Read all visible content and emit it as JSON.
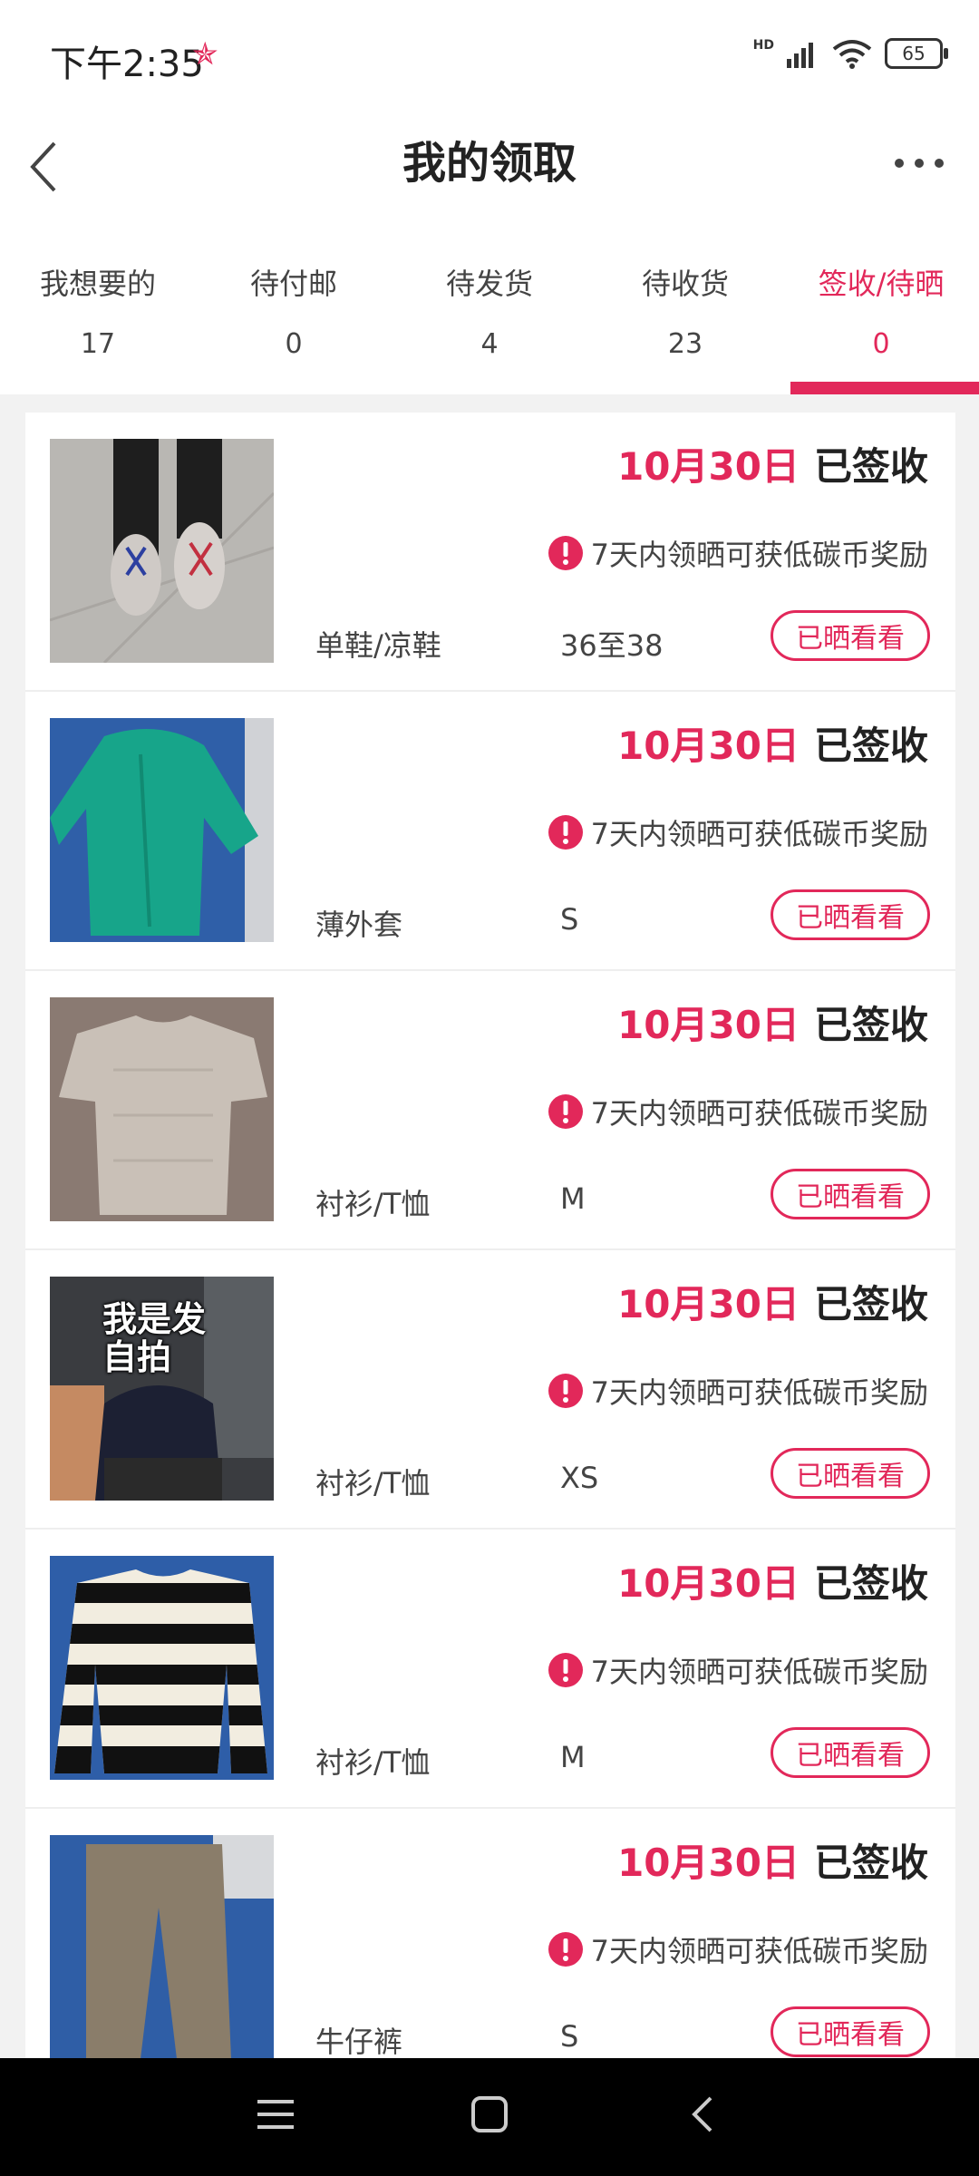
{
  "status_bar": {
    "time": "下午2:35",
    "battery": "65",
    "network": "HD"
  },
  "header": {
    "title": "我的领取"
  },
  "tabs": [
    {
      "label": "我想要的",
      "count": "17"
    },
    {
      "label": "待付邮",
      "count": "0"
    },
    {
      "label": "待发货",
      "count": "4"
    },
    {
      "label": "待收货",
      "count": "23"
    },
    {
      "label": "签收/待晒",
      "count": "0"
    }
  ],
  "active_tab": "签收/待晒",
  "colors": {
    "accent": "#e2285a",
    "text": "#333333",
    "background": "#f2f2f2"
  },
  "items": [
    {
      "date": "10月30日",
      "status": "已签收",
      "reward_text": "7天内领晒可获低碳币奖励",
      "category": "单鞋/凉鞋",
      "size": "36至38",
      "button": "已晒看看"
    },
    {
      "date": "10月30日",
      "status": "已签收",
      "reward_text": "7天内领晒可获低碳币奖励",
      "category": "薄外套",
      "size": "S",
      "button": "已晒看看"
    },
    {
      "date": "10月30日",
      "status": "已签收",
      "reward_text": "7天内领晒可获低碳币奖励",
      "category": "衬衫/T恤",
      "size": "M",
      "button": "已晒看看"
    },
    {
      "date": "10月30日",
      "status": "已签收",
      "reward_text": "7天内领晒可获低碳币奖励",
      "category": "衬衫/T恤",
      "size": "XS",
      "button": "已晒看看",
      "photo_overlay": "我是发自拍"
    },
    {
      "date": "10月30日",
      "status": "已签收",
      "reward_text": "7天内领晒可获低碳币奖励",
      "category": "衬衫/T恤",
      "size": "M",
      "button": "已晒看看"
    },
    {
      "date": "10月30日",
      "status": "已签收",
      "reward_text": "7天内领晒可获低碳币奖励",
      "category": "牛仔裤",
      "size": "S",
      "button": "已晒看看"
    }
  ]
}
